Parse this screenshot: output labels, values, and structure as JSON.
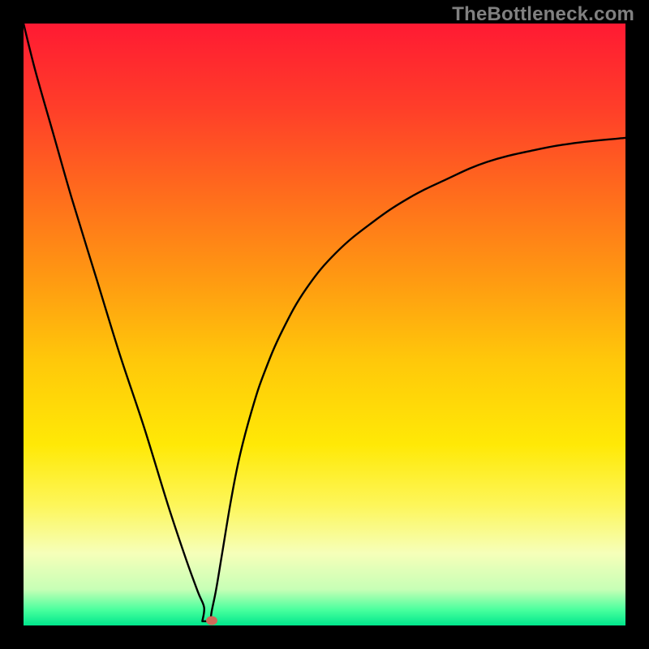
{
  "watermark": {
    "text": "TheBottleneck.com"
  },
  "colors": {
    "frame": "#000000",
    "watermark": "#808080",
    "curve": "#000000",
    "marker": "#cf6a5a",
    "gradient_stops": [
      {
        "offset": 0.0,
        "color": "#ff1a33"
      },
      {
        "offset": 0.14,
        "color": "#ff3e29"
      },
      {
        "offset": 0.28,
        "color": "#ff6b1d"
      },
      {
        "offset": 0.42,
        "color": "#ff9812"
      },
      {
        "offset": 0.56,
        "color": "#ffc80a"
      },
      {
        "offset": 0.7,
        "color": "#ffe906"
      },
      {
        "offset": 0.8,
        "color": "#fdf65a"
      },
      {
        "offset": 0.88,
        "color": "#f6ffb9"
      },
      {
        "offset": 0.94,
        "color": "#c7ffb6"
      },
      {
        "offset": 0.975,
        "color": "#46ff9d"
      },
      {
        "offset": 1.0,
        "color": "#00e68c"
      }
    ]
  },
  "chart_data": {
    "type": "line",
    "title": "",
    "xlabel": "",
    "ylabel": "",
    "xlim": [
      0,
      100
    ],
    "ylim": [
      0,
      100
    ],
    "grid": false,
    "series": [
      {
        "name": "bottleneck-curve",
        "x": [
          0.0,
          2.0,
          5.0,
          8.0,
          12.0,
          16.0,
          20.0,
          24.0,
          27.0,
          29.0,
          30.0,
          30.7,
          31.2,
          32.0,
          33.0,
          34.5,
          36.0,
          38.0,
          40.0,
          43.0,
          47.0,
          52.0,
          58.0,
          64.0,
          70.0,
          77.0,
          85.0,
          92.0,
          100.0
        ],
        "y": [
          100.0,
          92.0,
          81.5,
          71.0,
          58.0,
          45.0,
          33.0,
          20.0,
          11.0,
          5.5,
          3.0,
          0.7,
          2.0,
          6.0,
          12.0,
          21.0,
          28.5,
          36.0,
          42.0,
          49.0,
          56.0,
          62.0,
          67.0,
          71.0,
          74.0,
          77.0,
          79.0,
          80.2,
          81.0
        ]
      }
    ],
    "series_points": [
      {
        "name": "optimal-marker",
        "x": 31.2,
        "y": 0.8
      }
    ],
    "flat_valley": {
      "x_start": 29.7,
      "x_end": 31.2,
      "y": 0.7
    }
  }
}
